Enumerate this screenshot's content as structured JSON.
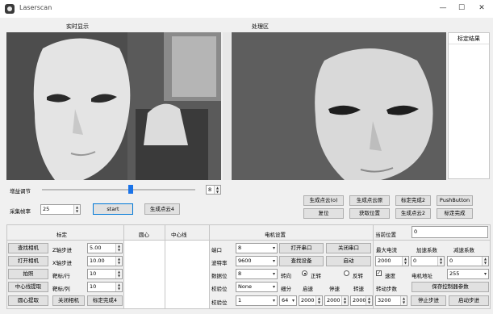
{
  "window": {
    "title": "Laserscan",
    "min_glyph": "—",
    "max_glyph": "☐",
    "close_glyph": "✕"
  },
  "panels": {
    "live_label": "实时显示",
    "process_label": "处理区",
    "result_label": "标定结果"
  },
  "gain": {
    "label": "增益调节",
    "value": "8",
    "level": 0.58
  },
  "framerate": {
    "label": "采集帧率",
    "value": "25"
  },
  "buttons": {
    "start": "start",
    "gen_pc4": "生成点云4",
    "gen_pc_o": "生成点云(o)",
    "gen_pc_orig": "生成点云原",
    "calib_done2": "标定完成2",
    "pushbutton": "PushButton",
    "reset": "复位",
    "get_pos": "获取位置",
    "gen_pc2": "生成点云2",
    "calib_done": "标定完成"
  },
  "sections": {
    "calib": "标定",
    "center": "圆心",
    "centerline": "中心线",
    "motor": "电机设置",
    "current_pos": "当前位置",
    "current_pos_value": "0"
  },
  "calib_rows": [
    {
      "btn": "查找相机",
      "label": "Z轴步进",
      "value": "5.00"
    },
    {
      "btn": "打开相机",
      "label": "X轴步进",
      "value": "10.00"
    },
    {
      "btn": "拍照",
      "label": "靶标/行",
      "value": "10"
    },
    {
      "btn": "中心线提取",
      "label": "靶标/列",
      "value": "10"
    }
  ],
  "calib_bottom": {
    "center_extract": "圆心提取",
    "close_camera": "关闭相机",
    "calib_done4": "标定完成4"
  },
  "motor": {
    "port_label": "端口",
    "port_value": "8",
    "open_serial": "打开串口",
    "close_serial": "关闭串口",
    "baud_label": "波特率",
    "baud_value": "9600",
    "find_device": "查找设备",
    "start": "启动",
    "data_label": "数据位",
    "data_value": "8",
    "dir_label": "转向",
    "forward": "正转",
    "reverse": "反转",
    "parity_label": "校验位",
    "parity_value": "None",
    "subdiv_label": "细分",
    "accel_label": "启速",
    "decel_label": "停速",
    "speed_label": "转速",
    "steps_label": "转动步数",
    "stop_label": "校验位",
    "stop_value": "1",
    "subdiv_value": "64",
    "accel_value": "2000",
    "decel_value": "2000",
    "speed_value": "2000",
    "steps_value": "3200",
    "max_current_label": "最大电流",
    "accel_coef_label": "加速系数",
    "decel_coef_label": "减速系数",
    "max_current_value": "2000",
    "accel_coef_value": "0",
    "decel_coef_value": "0",
    "speed_check_label": "速度",
    "motor_addr_label": "电机地址",
    "motor_addr_value": "255",
    "save_params": "保存控制器参数",
    "stop_step": "停止步进",
    "start_step": "启动步进"
  }
}
